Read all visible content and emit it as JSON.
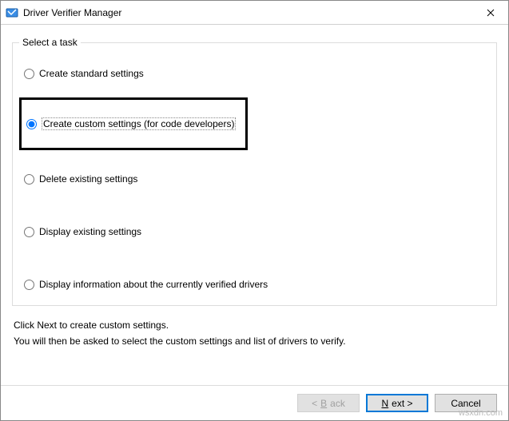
{
  "window": {
    "title": "Driver Verifier Manager"
  },
  "group": {
    "legend": "Select a task"
  },
  "options": {
    "create_standard": "Create standard settings",
    "create_custom": "Create custom settings (for code developers)",
    "delete_existing": "Delete existing settings",
    "display_existing": "Display existing settings",
    "display_info": "Display information about the currently verified drivers"
  },
  "instructions": {
    "line1": "Click Next to create custom settings.",
    "line2": "You will then be asked to select the custom settings and list of drivers to verify."
  },
  "buttons": {
    "back_prefix": "< ",
    "back_m": "B",
    "back_suffix": "ack",
    "next_m": "N",
    "next_suffix": "ext >",
    "cancel": "Cancel"
  },
  "watermark": "wsxdn.com"
}
